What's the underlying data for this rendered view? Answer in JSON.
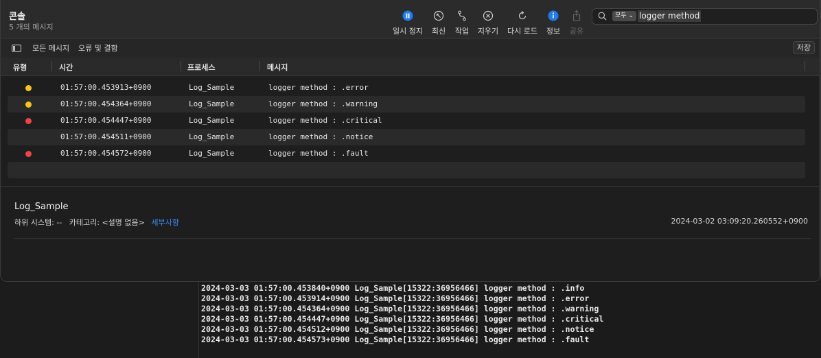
{
  "header": {
    "title": "콘솔",
    "subtitle": "5 개의 메시지"
  },
  "toolbar": {
    "pause": "일시 정지",
    "refresh": "최신",
    "actions": "작업",
    "clear": "지우기",
    "reload": "다시 로드",
    "info": "정보",
    "share": "공유"
  },
  "search": {
    "scope": "모두",
    "query": "logger method"
  },
  "subbar": {
    "all_messages": "모든 메시지",
    "errors_faults": "오류 및 결함",
    "save": "저장"
  },
  "columns": {
    "type": "유형",
    "time": "시간",
    "process": "프로세스",
    "message": "메시지"
  },
  "rows": [
    {
      "time": "01:57:00.453913+0900",
      "process": "Log_Sample",
      "message": "logger method : .error",
      "level_color": "#f5c518"
    },
    {
      "time": "01:57:00.454364+0900",
      "process": "Log_Sample",
      "message": "logger method : .warning",
      "level_color": "#f5c518"
    },
    {
      "time": "01:57:00.454447+0900",
      "process": "Log_Sample",
      "message": "logger method : .critical",
      "level_color": "#ef4444"
    },
    {
      "time": "01:57:00.454511+0900",
      "process": "Log_Sample",
      "message": "logger method : .notice",
      "level_color": ""
    },
    {
      "time": "01:57:00.454572+0900",
      "process": "Log_Sample",
      "message": "logger method : .fault",
      "level_color": "#ef4444"
    }
  ],
  "detail": {
    "process": "Log_Sample",
    "subsystem_label": "하위 시스템:",
    "subsystem_value": "--",
    "category_label": "카테고리:",
    "category_value": "<설명 없음>",
    "details_link": "세부사항",
    "timestamp": "2024-03-02 03:09:20.260552+0900"
  },
  "terminal": {
    "lines": [
      "2024-03-03 01:57:00.453840+0900 Log_Sample[15322:36956466] logger method : .info",
      "2024-03-03 01:57:00.453914+0900 Log_Sample[15322:36956466] logger method : .error",
      "2024-03-03 01:57:00.454364+0900 Log_Sample[15322:36956466] logger method : .warning",
      "2024-03-03 01:57:00.454447+0900 Log_Sample[15322:36956466] logger method : .critical",
      "2024-03-03 01:57:00.454512+0900 Log_Sample[15322:36956466] logger method : .notice",
      "2024-03-03 01:57:00.454573+0900 Log_Sample[15322:36956466] logger method : .fault"
    ]
  },
  "colors": {
    "accent": "#3b8ff6",
    "pause_active": "#1f7cf0"
  },
  "icons": [
    "pause-icon",
    "refresh-icon",
    "actions-icon",
    "clear-icon",
    "reload-icon",
    "info-icon",
    "share-icon",
    "search-icon",
    "sidebar-icon"
  ]
}
